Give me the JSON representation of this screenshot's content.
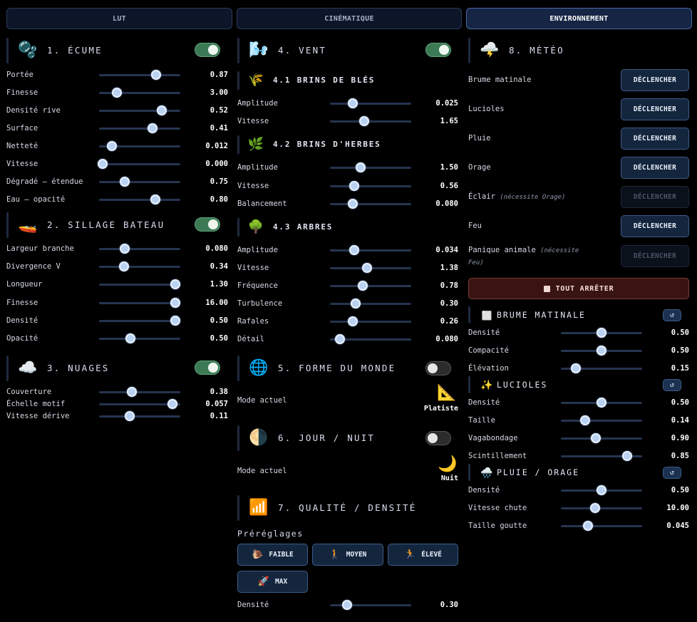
{
  "tabs": [
    {
      "label": "LUT",
      "active": false
    },
    {
      "label": "CINÉMATIQUE",
      "active": false
    },
    {
      "label": "ENVIRONNEMENT",
      "active": true
    }
  ],
  "col1": {
    "ecume": {
      "title": "1. ÉCUME",
      "icon": "bubbles-icon",
      "toggle_on": true,
      "rows": [
        {
          "label": "Portée",
          "value": "0.87",
          "level": 0.7
        },
        {
          "label": "Finesse",
          "value": "3.00",
          "level": 0.22
        },
        {
          "label": "Densité rive",
          "value": "0.52",
          "level": 0.77
        },
        {
          "label": "Surface",
          "value": "0.41",
          "level": 0.66
        },
        {
          "label": "Netteté",
          "value": "0.012",
          "level": 0.16
        },
        {
          "label": "Vitesse",
          "value": "0.000",
          "level": 0.04
        },
        {
          "label": "Dégradé — étendue",
          "value": "0.75",
          "level": 0.32
        },
        {
          "label": "Eau — opacité",
          "value": "0.80",
          "level": 0.69
        }
      ]
    },
    "sillage": {
      "title": "2. SILLAGE BATEAU",
      "icon": "boat-icon",
      "toggle_on": true,
      "rows": [
        {
          "label": "Largeur branche",
          "value": "0.080",
          "level": 0.32
        },
        {
          "label": "Divergence V",
          "value": "0.34",
          "level": 0.31
        },
        {
          "label": "Longueur",
          "value": "1.30",
          "level": 0.94
        },
        {
          "label": "Finesse",
          "value": "16.00",
          "level": 0.94
        },
        {
          "label": "Densité",
          "value": "0.50",
          "level": 0.94
        },
        {
          "label": "Opacité",
          "value": "0.50",
          "level": 0.39
        }
      ]
    },
    "nuages": {
      "title": "3. NUAGES",
      "icon": "cloud-icon",
      "toggle_on": true,
      "rows": [
        {
          "label": "Couverture",
          "value": "0.38",
          "level": 0.4
        },
        {
          "label": "Échelle motif",
          "value": "0.057",
          "level": 0.9
        },
        {
          "label": "Vitesse dérive",
          "value": "0.11",
          "level": 0.38
        }
      ]
    }
  },
  "col2": {
    "vent": {
      "title": "4. VENT",
      "icon": "wind-icon",
      "toggle_on": true
    },
    "bles": {
      "title": "4.1 BRINS DE BLÉS",
      "icon": "wheat-icon",
      "rows": [
        {
          "label": "Amplitude",
          "value": "0.025",
          "level": 0.28
        },
        {
          "label": "Vitesse",
          "value": "1.65",
          "level": 0.42
        }
      ]
    },
    "herbes": {
      "title": "4.2 BRINS D'HERBES",
      "icon": "herb-icon",
      "rows": [
        {
          "label": "Amplitude",
          "value": "1.50",
          "level": 0.38
        },
        {
          "label": "Vitesse",
          "value": "0.56",
          "level": 0.3
        },
        {
          "label": "Balancement",
          "value": "0.080",
          "level": 0.28
        }
      ]
    },
    "arbres": {
      "title": "4.3 ARBRES",
      "icon": "tree-icon",
      "rows": [
        {
          "label": "Amplitude",
          "value": "0.034",
          "level": 0.3
        },
        {
          "label": "Vitesse",
          "value": "1.38",
          "level": 0.46
        },
        {
          "label": "Fréquence",
          "value": "0.78",
          "level": 0.4
        },
        {
          "label": "Turbulence",
          "value": "0.30",
          "level": 0.32
        },
        {
          "label": "Rafales",
          "value": "0.26",
          "level": 0.28
        },
        {
          "label": "Détail",
          "value": "0.080",
          "level": 0.12
        }
      ]
    },
    "monde": {
      "title": "5. FORME DU MONDE",
      "icon": "globe-icon",
      "toggle_on": false,
      "mode_label": "Mode actuel",
      "mode_value": "Platiste",
      "mode_icon": "triangle-ruler-icon"
    },
    "jour": {
      "title": "6. JOUR / NUIT",
      "icon": "moon-phase-icon",
      "toggle_on": false,
      "mode_label": "Mode actuel",
      "mode_value": "Nuit",
      "mode_icon": "crescent-moon-icon"
    },
    "qualite": {
      "title": "7. QUALITÉ / DENSITÉ",
      "icon": "quality-icon",
      "presets_title": "Préréglages",
      "presets": [
        {
          "label": "FAIBLE",
          "icon": "snail-icon"
        },
        {
          "label": "MOYEN",
          "icon": "walker-icon"
        },
        {
          "label": "ÉLEVÉ",
          "icon": "runner-icon"
        },
        {
          "label": "MAX",
          "icon": "rocket-icon"
        }
      ],
      "rows": [
        {
          "label": "Densité",
          "value": "0.30",
          "level": 0.21
        }
      ]
    }
  },
  "col3": {
    "meteo": {
      "title": "8. MÉTÉO",
      "icon": "storm-cloud-icon",
      "events": [
        {
          "label": "Brume matinale",
          "note": "",
          "button": "DÉCLENCHER",
          "enabled": true
        },
        {
          "label": "Lucioles",
          "note": "",
          "button": "DÉCLENCHER",
          "enabled": true
        },
        {
          "label": "Pluie",
          "note": "",
          "button": "DÉCLENCHER",
          "enabled": true
        },
        {
          "label": "Orage",
          "note": "",
          "button": "DÉCLENCHER",
          "enabled": true
        },
        {
          "label": "Éclair",
          "note": "(nécessite Orage)",
          "button": "DÉCLENCHER",
          "enabled": false
        },
        {
          "label": "Feu",
          "note": "",
          "button": "DÉCLENCHER",
          "enabled": true
        },
        {
          "label": "Panique animale",
          "note": "(nécessite Feu)",
          "button": "DÉCLENCHER",
          "enabled": false
        }
      ],
      "stop_all": "TOUT ARRÊTER"
    },
    "brume": {
      "title": "BRUME MATINALE",
      "icon": "fog-square-icon",
      "reset": "↺",
      "rows": [
        {
          "label": "Densité",
          "value": "0.50",
          "level": 0.5
        },
        {
          "label": "Compacité",
          "value": "0.50",
          "level": 0.5
        },
        {
          "label": "Élévation",
          "value": "0.15",
          "level": 0.18
        }
      ]
    },
    "lucioles": {
      "title": "LUCIOLES",
      "icon": "sparkles-icon",
      "reset": "↺",
      "rows": [
        {
          "label": "Densité",
          "value": "0.50",
          "level": 0.5
        },
        {
          "label": "Taille",
          "value": "0.14",
          "level": 0.3
        },
        {
          "label": "Vagabondage",
          "value": "0.90",
          "level": 0.43
        },
        {
          "label": "Scintillement",
          "value": "0.85",
          "level": 0.82
        }
      ]
    },
    "pluie": {
      "title": "PLUIE / ORAGE",
      "icon": "rain-cloud-icon",
      "reset": "↺",
      "rows": [
        {
          "label": "Densité",
          "value": "0.50",
          "level": 0.5
        },
        {
          "label": "Vitesse chute",
          "value": "10.00",
          "level": 0.42
        },
        {
          "label": "Taille goutte",
          "value": "0.045",
          "level": 0.33
        }
      ]
    }
  }
}
